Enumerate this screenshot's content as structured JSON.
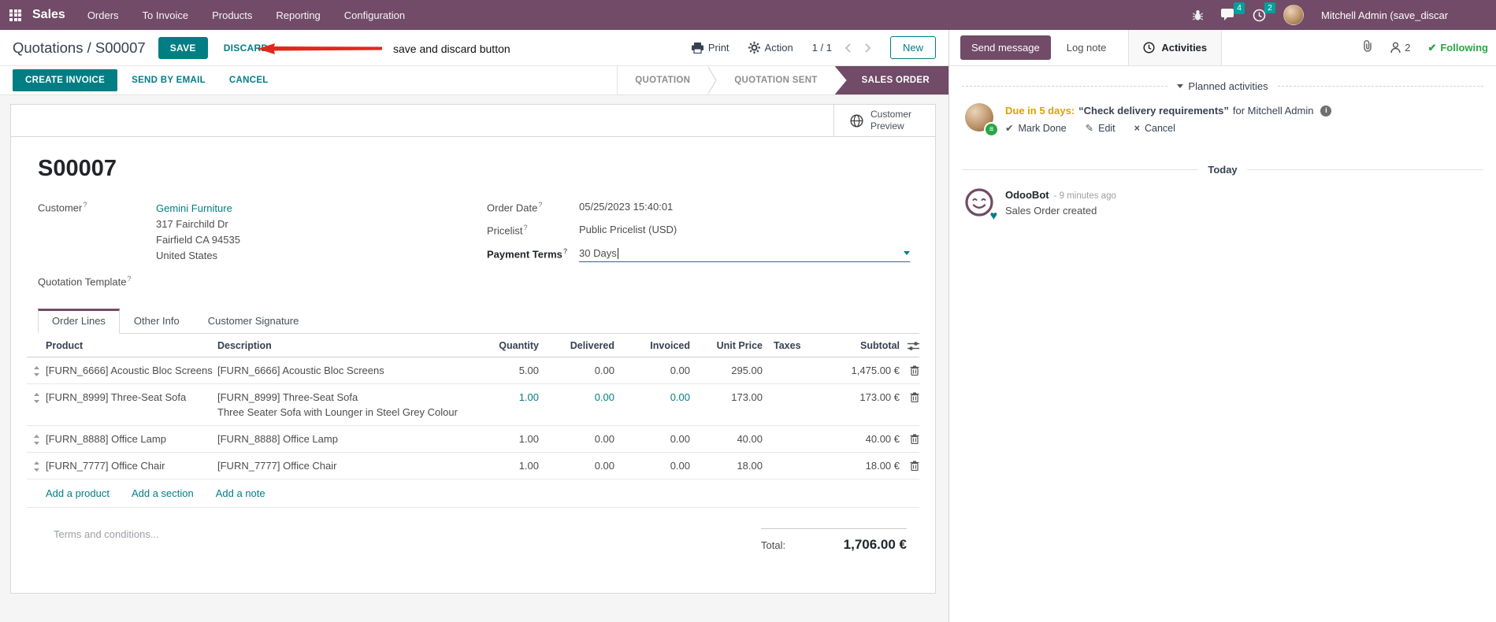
{
  "colors": {
    "brand_purple": "#714B67",
    "accent_teal": "#017E84",
    "badge_teal": "#00A09D",
    "following_green": "#28a745",
    "due_orange": "#d9a300",
    "annotation_red": "#e3261d"
  },
  "nav": {
    "app": "Sales",
    "menus": [
      "Orders",
      "To Invoice",
      "Products",
      "Reporting",
      "Configuration"
    ],
    "messages_badge": "4",
    "activities_badge": "2",
    "user": "Mitchell Admin (save_discar"
  },
  "control": {
    "breadcrumb": "Quotations / S00007",
    "save": "SAVE",
    "discard": "DISCARD",
    "annotation": "save and discard button",
    "print": "Print",
    "action": "Action",
    "pager": "1 / 1",
    "new": "New"
  },
  "statusbar": {
    "create_invoice": "CREATE INVOICE",
    "send_by_email": "SEND BY EMAIL",
    "cancel": "CANCEL",
    "states": [
      {
        "label": "QUOTATION"
      },
      {
        "label": "QUOTATION SENT"
      },
      {
        "label": "SALES ORDER"
      }
    ]
  },
  "sheet": {
    "customer_preview": "Customer Preview",
    "title": "S00007",
    "fields": {
      "hint": "?",
      "customer_label": "Customer",
      "customer_value": "Gemini Furniture",
      "address_line1": "317 Fairchild Dr",
      "address_line2": "Fairfield CA 94535",
      "address_line3": "United States",
      "quotation_template_label": "Quotation Template",
      "order_date_label": "Order Date",
      "order_date_value": "05/25/2023 15:40:01",
      "pricelist_label": "Pricelist",
      "pricelist_value": "Public Pricelist (USD)",
      "payment_terms_label": "Payment Terms",
      "payment_terms_value": "30 Days"
    },
    "tabs": [
      "Order Lines",
      "Other Info",
      "Customer Signature"
    ],
    "table": {
      "headers": [
        "Product",
        "Description",
        "Quantity",
        "Delivered",
        "Invoiced",
        "Unit Price",
        "Taxes",
        "Subtotal"
      ],
      "rows": [
        {
          "product": "[FURN_6666] Acoustic Bloc Screens",
          "desc": "[FURN_6666] Acoustic Bloc Screens",
          "desc2": "",
          "qty": "5.00",
          "delivered": "0.00",
          "invoiced": "0.00",
          "unit_price": "295.00",
          "taxes": "",
          "subtotal": "1,475.00 €"
        },
        {
          "product": "[FURN_8999] Three-Seat Sofa",
          "desc": "[FURN_8999] Three-Seat Sofa",
          "desc2": "Three Seater Sofa with Lounger in Steel Grey Colour",
          "qty": "1.00",
          "delivered": "0.00",
          "invoiced": "0.00",
          "unit_price": "173.00",
          "taxes": "",
          "subtotal": "173.00 €"
        },
        {
          "product": "[FURN_8888] Office Lamp",
          "desc": "[FURN_8888] Office Lamp",
          "desc2": "",
          "qty": "1.00",
          "delivered": "0.00",
          "invoiced": "0.00",
          "unit_price": "40.00",
          "taxes": "",
          "subtotal": "40.00 €"
        },
        {
          "product": "[FURN_7777] Office Chair",
          "desc": "[FURN_7777] Office Chair",
          "desc2": "",
          "qty": "1.00",
          "delivered": "0.00",
          "invoiced": "0.00",
          "unit_price": "18.00",
          "taxes": "",
          "subtotal": "18.00 €"
        }
      ],
      "links": [
        "Add a product",
        "Add a section",
        "Add a note"
      ]
    },
    "terms_placeholder": "Terms and conditions...",
    "total_label": "Total:",
    "total_value": "1,706.00 €"
  },
  "chatter": {
    "send_message": "Send message",
    "log_note": "Log note",
    "activities": "Activities",
    "followers": "2",
    "following": "Following",
    "planned_header": "Planned activities",
    "activity": {
      "due": "Due in 5 days:",
      "summary": "“Check delivery requirements”",
      "assignee": "for Mitchell Admin",
      "mark_done": "Mark Done",
      "edit": "Edit",
      "cancel": "Cancel"
    },
    "today": "Today",
    "message": {
      "author": "OdooBot",
      "time": "- 9 minutes ago",
      "body": "Sales Order created"
    }
  },
  "icons": [
    "apps-grid-icon",
    "bug-icon",
    "chat-icon",
    "clock-icon",
    "printer-icon",
    "gear-icon",
    "chevron-left-icon",
    "chevron-right-icon",
    "globe-icon",
    "dropdown-caret-icon",
    "drag-handle-icon",
    "trash-icon",
    "column-options-icon",
    "paperclip-icon",
    "followers-icon",
    "check-icon",
    "pencil-icon",
    "close-icon",
    "info-icon",
    "heart-icon",
    "list-badge-icon"
  ]
}
